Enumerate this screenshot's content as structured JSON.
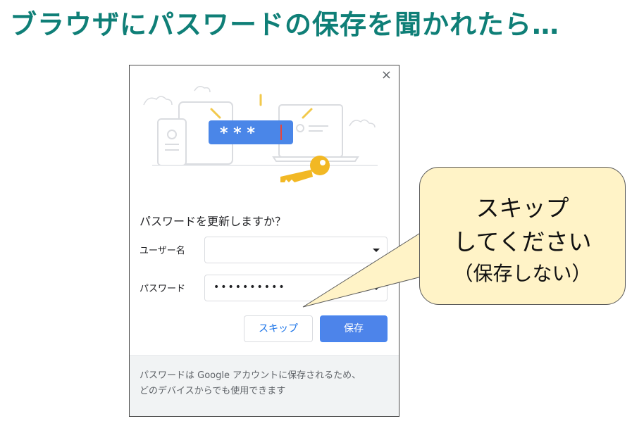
{
  "heading": "ブラウザにパスワードの保存を聞かれたら…",
  "dialog": {
    "close_label": "×",
    "question": "パスワードを更新しますか？",
    "username_label": "ユーザー名",
    "username_value": "",
    "password_label": "パスワード",
    "password_value": "••••••••••",
    "skip_label": "スキップ",
    "save_label": "保存",
    "masked_display": "* * *",
    "footer_line1": "パスワードは Google アカウントに保存されるため、",
    "footer_line2": "どのデバイスからでも使用できます"
  },
  "callout": {
    "line1": "スキップ",
    "line2": "してください",
    "line3": "（保存しない）"
  },
  "colors": {
    "heading": "#0f7f77",
    "primary_button": "#4d84ea",
    "callout_fill": "#fff3c7",
    "key": "#f2b824"
  },
  "icons": [
    "close-icon",
    "dropdown-caret-icon",
    "phone-icon",
    "laptop-icon",
    "key-icon",
    "cloud-icon"
  ]
}
